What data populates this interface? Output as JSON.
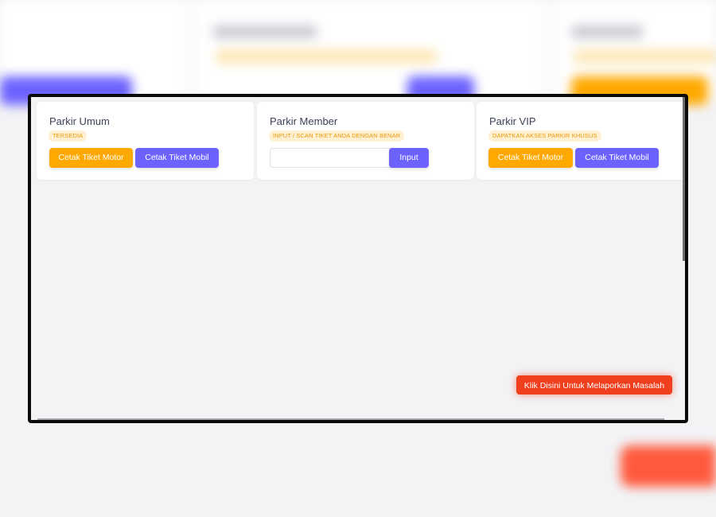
{
  "colors": {
    "orange": "#ffa900",
    "purple": "#6c63ff",
    "report_red": "#f13f1e",
    "pill_bg": "#fff0d2",
    "pill_text": "#e89a0c"
  },
  "cards": [
    {
      "title": "Parkir Umum",
      "badge": "TERSEDIA",
      "buttons": [
        "Cetak Tiket Motor",
        "Cetak Tiket Mobil"
      ]
    },
    {
      "title": "Parkir Member",
      "badge": "INPUT / SCAN TIKET ANDA DENGAN BENAR",
      "input_value": "",
      "input_placeholder": "",
      "button": "Input"
    },
    {
      "title": "Parkir VIP",
      "badge": "DAPATKAN AKSES PARKIR KHUSUS",
      "buttons": [
        "Cetak Tiket Motor",
        "Cetak Tiket Mobil"
      ]
    }
  ],
  "report_button": "Klik Disini Untuk Melaporkan Masalah"
}
